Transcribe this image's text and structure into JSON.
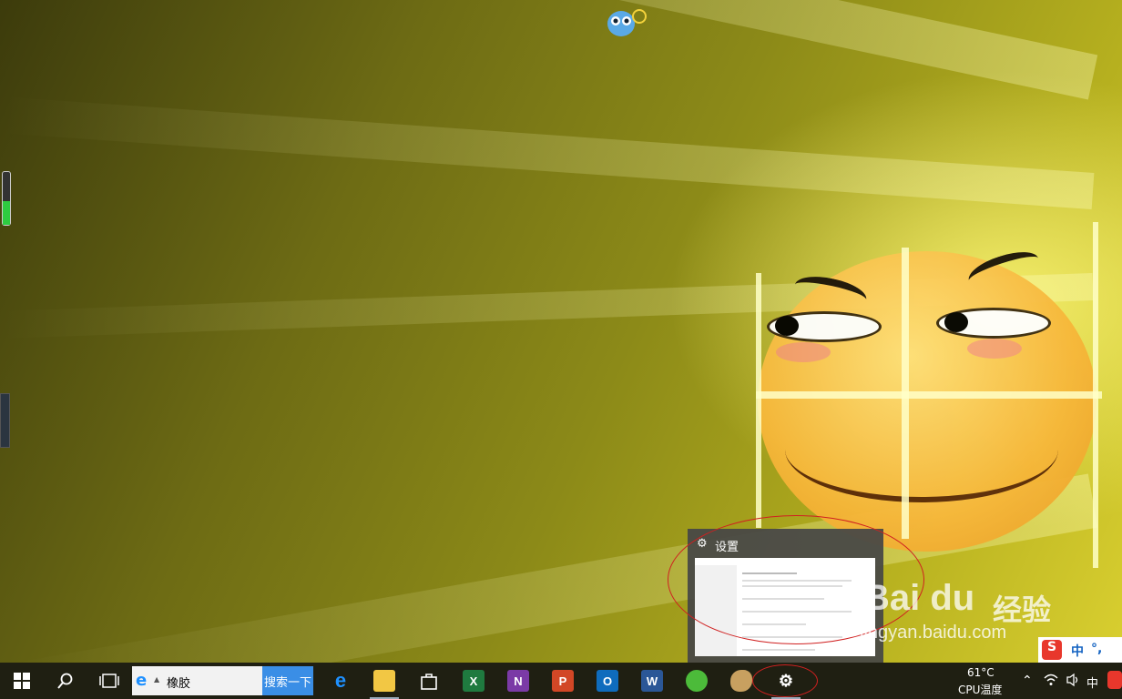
{
  "desktop": {
    "top_widget_icon": "owl-mascot-icon",
    "gauge_level": 0.45
  },
  "preview": {
    "title": "设置",
    "icon": "gear-icon"
  },
  "watermark": {
    "brand": "Bai du",
    "brand_cn": "经验",
    "url": "jingyan.baidu.com"
  },
  "ime_float": {
    "mode": "中",
    "punct": "°,"
  },
  "taskbar": {
    "search_value": "橡胶",
    "search_button": "搜索一下",
    "apps": [
      {
        "name": "edge",
        "label": "e",
        "color": "#1e90ff"
      },
      {
        "name": "file-explorer",
        "label": "",
        "color": "#f2c744"
      },
      {
        "name": "store",
        "label": "",
        "color": "#ffffff"
      },
      {
        "name": "excel",
        "label": "X",
        "color": "#1f7a3f"
      },
      {
        "name": "onenote",
        "label": "N",
        "color": "#7b3aa6"
      },
      {
        "name": "powerpoint",
        "label": "P",
        "color": "#d24726"
      },
      {
        "name": "outlook",
        "label": "O",
        "color": "#0f6cbd"
      },
      {
        "name": "word",
        "label": "W",
        "color": "#2b5797"
      },
      {
        "name": "refresh-app",
        "label": "",
        "color": "#4cbb3a"
      },
      {
        "name": "paint",
        "label": "",
        "color": "#c8a060"
      },
      {
        "name": "settings",
        "label": "⚙",
        "color": "#555555"
      }
    ],
    "cpu_temp": "61°C",
    "cpu_label": "CPU温度",
    "ime": "中"
  }
}
